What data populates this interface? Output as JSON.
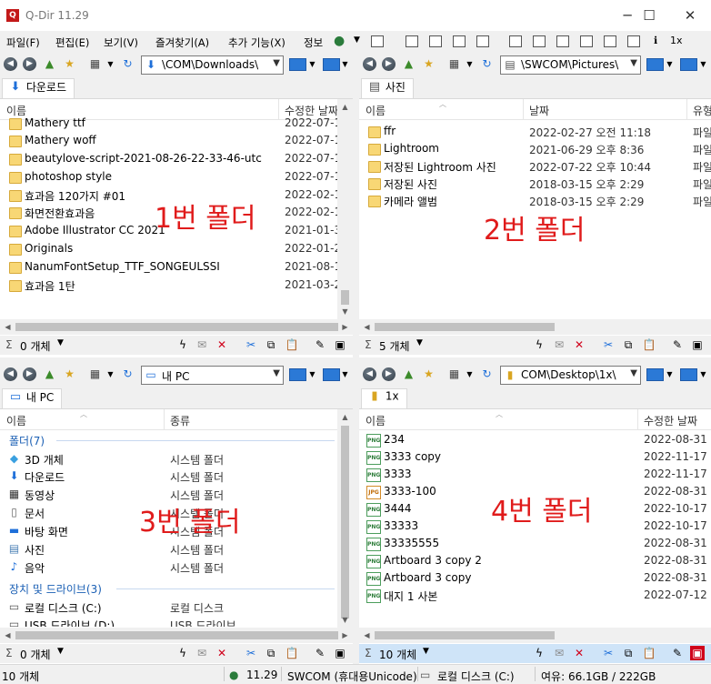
{
  "window": {
    "title": "Q-Dir 11.29",
    "buttons": [
      "─",
      "☐",
      "✕"
    ]
  },
  "menu": {
    "items": [
      "파일(F)",
      "편집(E)",
      "보기(V)",
      "즐겨찾기(A)",
      "추가 기능(X)",
      "정보"
    ],
    "zoom_label": "1x"
  },
  "panes": {
    "p1": {
      "address": "\\COM\\Downloads\\",
      "tab": "다운로드",
      "columns": [
        "이름",
        "수정한 날짜"
      ],
      "rows": [
        {
          "name": "Mathery ttf",
          "date": "2022-07-1"
        },
        {
          "name": "Mathery woff",
          "date": "2022-07-1"
        },
        {
          "name": "beautylove-script-2021-08-26-22-33-46-utc",
          "date": "2022-07-1"
        },
        {
          "name": "photoshop style",
          "date": "2022-07-1"
        },
        {
          "name": "효과음 120가지 #01",
          "date": "2022-02-1"
        },
        {
          "name": "화면전환효과음",
          "date": "2022-02-1"
        },
        {
          "name": "Adobe Illustrator CC 2021",
          "date": "2021-01-3"
        },
        {
          "name": "Originals",
          "date": "2022-01-2"
        },
        {
          "name": "NanumFontSetup_TTF_SONGEULSSI",
          "date": "2021-08-1"
        },
        {
          "name": "효과음 1탄",
          "date": "2021-03-2"
        }
      ],
      "status": "0 개체",
      "overlay": "1번 폴더"
    },
    "p2": {
      "address": "\\SWCOM\\Pictures\\",
      "tab": "사진",
      "columns": [
        "이름",
        "날짜",
        "유형"
      ],
      "rows": [
        {
          "name": "ffr",
          "date": "2022-02-27 오전 11:18",
          "type": "파일"
        },
        {
          "name": "Lightroom",
          "date": "2021-06-29 오후 8:36",
          "type": "파일"
        },
        {
          "name": "저장된 Lightroom 사진",
          "date": "2022-07-22 오후 10:44",
          "type": "파일"
        },
        {
          "name": "저장된 사진",
          "date": "2018-03-15 오후 2:29",
          "type": "파일"
        },
        {
          "name": "카메라 앨범",
          "date": "2018-03-15 오후 2:29",
          "type": "파일"
        }
      ],
      "status": "5 개체",
      "overlay": "2번 폴더"
    },
    "p3": {
      "address": "내 PC",
      "tab": "내 PC",
      "columns": [
        "이름",
        "종류"
      ],
      "group1": "폴더(7)",
      "folders": [
        {
          "name": "3D 개체",
          "kind": "시스템 폴더",
          "icon": "cube-icon"
        },
        {
          "name": "다운로드",
          "kind": "시스템 폴더",
          "icon": "download-icon"
        },
        {
          "name": "동영상",
          "kind": "시스템 폴더",
          "icon": "film-icon"
        },
        {
          "name": "문서",
          "kind": "시스템 폴더",
          "icon": "document-icon"
        },
        {
          "name": "바탕 화면",
          "kind": "시스템 폴더",
          "icon": "desktop-icon"
        },
        {
          "name": "사진",
          "kind": "시스템 폴더",
          "icon": "picture-icon"
        },
        {
          "name": "음악",
          "kind": "시스템 폴더",
          "icon": "music-icon"
        }
      ],
      "group2": "장치 및 드라이브(3)",
      "drives": [
        {
          "name": "로컬 디스크 (C:)",
          "kind": "로컬 디스크"
        },
        {
          "name": "USB 드라이브 (D:)",
          "kind": "USB 드라이브"
        }
      ],
      "status": "0 개체",
      "overlay": "3번 폴더"
    },
    "p4": {
      "address": "COM\\Desktop\\1x\\",
      "tab": "1x",
      "columns": [
        "이름",
        "수정한 날짜"
      ],
      "rows": [
        {
          "name": "234",
          "date": "2022-08-31",
          "ext": "PNG"
        },
        {
          "name": "3333 copy",
          "date": "2022-11-17",
          "ext": "PNG"
        },
        {
          "name": "3333",
          "date": "2022-11-17",
          "ext": "PNG"
        },
        {
          "name": "3333-100",
          "date": "2022-08-31",
          "ext": "JPG"
        },
        {
          "name": "3444",
          "date": "2022-10-17",
          "ext": "PNG"
        },
        {
          "name": "33333",
          "date": "2022-10-17",
          "ext": "PNG"
        },
        {
          "name": "33335555",
          "date": "2022-08-31",
          "ext": "PNG"
        },
        {
          "name": "Artboard 3 copy 2",
          "date": "2022-08-31",
          "ext": "PNG"
        },
        {
          "name": "Artboard 3 copy",
          "date": "2022-08-31",
          "ext": "PNG"
        },
        {
          "name": "대지 1 사본",
          "date": "2022-07-12",
          "ext": "PNG"
        }
      ],
      "status": "10 개체",
      "overlay": "4번 폴더"
    }
  },
  "statusbar": {
    "count": "10 개체",
    "version": "11.29",
    "user": "SWCOM (휴대용Unicode)",
    "drive": "로컬 디스크 (C:)",
    "free": "여유: 66.1GB / 222GB"
  },
  "colors": {
    "folder": "#f8d775",
    "overlay_text": "#e01b1b",
    "active_status": "#cfe4f8",
    "accent": "#2b79d6"
  }
}
